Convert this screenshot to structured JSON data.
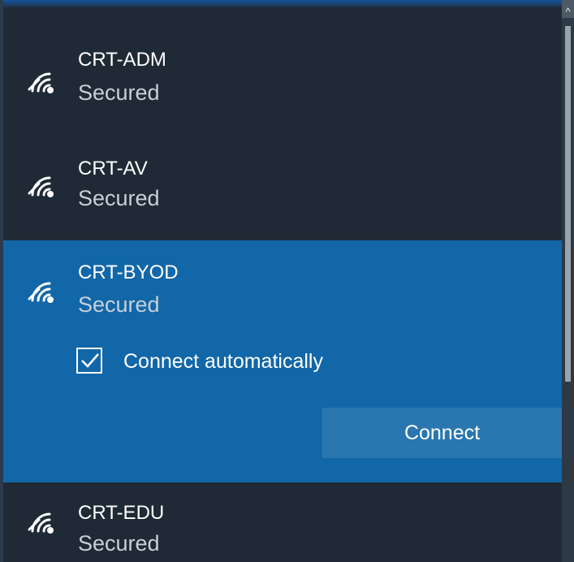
{
  "networks": [
    {
      "name": "CRT-ADM",
      "status": "Secured"
    },
    {
      "name": "CRT-AV",
      "status": "Secured"
    },
    {
      "name": "CRT-BYOD",
      "status": "Secured",
      "selected": true,
      "connect_automatically": true
    },
    {
      "name": "CRT-EDU",
      "status": "Secured"
    }
  ],
  "selected_network": {
    "auto_connect_label": "Connect automatically",
    "connect_button_label": "Connect"
  },
  "icons": {
    "network": "wifi-signal-icon",
    "checkbox": "checkmark-icon",
    "scroll_up": "chevron-up-icon"
  },
  "colors": {
    "background": "#1f2a36",
    "selected_background": "#1267a8",
    "button_background": "#2a76b0",
    "text": "#ffffff",
    "secondary_text": "#c7cfd8"
  }
}
